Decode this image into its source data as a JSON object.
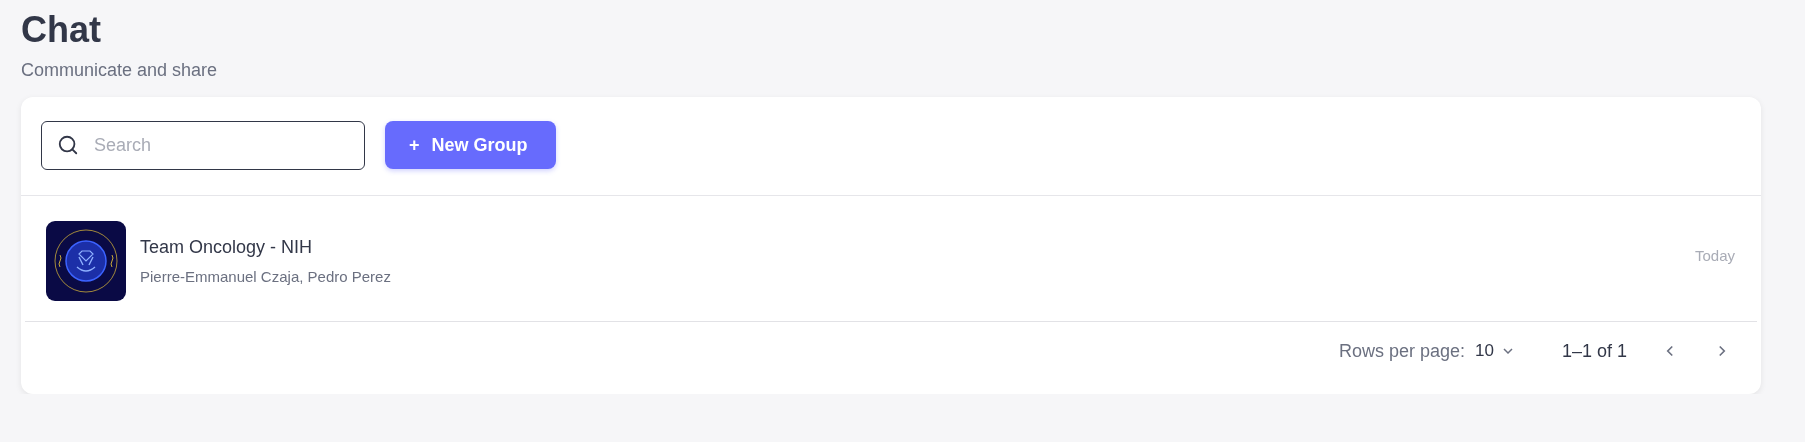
{
  "header": {
    "title": "Chat",
    "subtitle": "Communicate and share"
  },
  "toolbar": {
    "search": {
      "placeholder": "Search"
    },
    "new_button": {
      "icon": "+",
      "label": "New Group"
    }
  },
  "chats": [
    {
      "name": "Team Oncology - NIH",
      "members": "Pierre-Emmanuel Czaja, Pedro Perez",
      "time": "Today"
    }
  ],
  "pagination": {
    "rows_label": "Rows per page:",
    "rows_value": "10",
    "range": "1–1 of 1",
    "prev_disabled": false,
    "next_disabled": false
  }
}
